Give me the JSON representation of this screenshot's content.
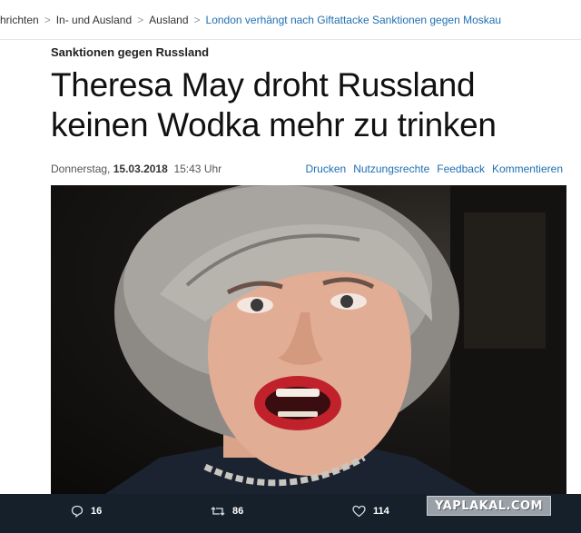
{
  "breadcrumb": {
    "items": [
      "hrichten",
      "In- und Ausland",
      "Ausland"
    ],
    "current": "London verhängt nach Giftattacke Sanktionen gegen Moskau"
  },
  "article": {
    "kicker": "Sanktionen gegen Russland",
    "headline": "Theresa May droht Russland keinen Wodka mehr zu trinken",
    "weekday": "Donnerstag,",
    "date": "15.03.2018",
    "time": "15:43 Uhr",
    "actions": [
      "Drucken",
      "Nutzungsrechte",
      "Feedback",
      "Kommentieren"
    ],
    "photo_subject": "portrait-photo"
  },
  "tweet_stats": {
    "replies": "16",
    "retweets": "86",
    "likes": "114"
  },
  "watermark": "YAPLAKAL.COM",
  "colors": {
    "link": "#1f6fb2",
    "tweet_bar": "#15202b",
    "lips": "#c0212a"
  }
}
